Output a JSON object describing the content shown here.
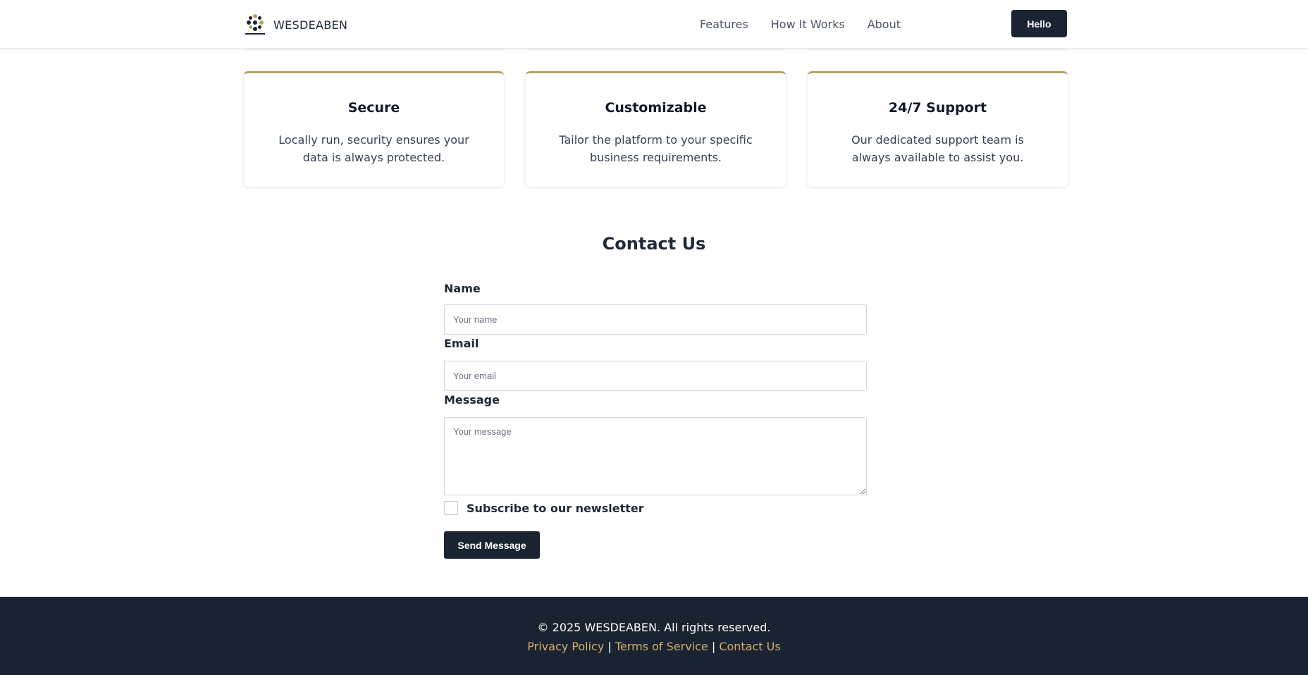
{
  "header": {
    "brand": "WESDEABEN",
    "nav": [
      "Features",
      "How It Works",
      "About"
    ],
    "cta_label": "Hello"
  },
  "features": [
    {
      "title": "Secure",
      "description": "Locally run, security ensures your data is always protected."
    },
    {
      "title": "Customizable",
      "description": "Tailor the platform to your specific business requirements."
    },
    {
      "title": "24/7 Support",
      "description": "Our dedicated support team is always available to assist you."
    }
  ],
  "contact": {
    "title": "Contact Us",
    "name_label": "Name",
    "name_placeholder": "Your name",
    "email_label": "Email",
    "email_placeholder": "Your email",
    "message_label": "Message",
    "message_placeholder": "Your message",
    "newsletter_label": "Subscribe to our newsletter",
    "submit_label": "Send Message"
  },
  "footer": {
    "copyright": "© 2025 WESDEABEN. All rights reserved.",
    "links": [
      "Privacy Policy",
      "Terms of Service",
      "Contact Us"
    ],
    "separator": "|"
  },
  "colors": {
    "primary_dark": "#1a2332",
    "accent_gold": "#b8a065",
    "footer_link": "#d4b06a"
  }
}
